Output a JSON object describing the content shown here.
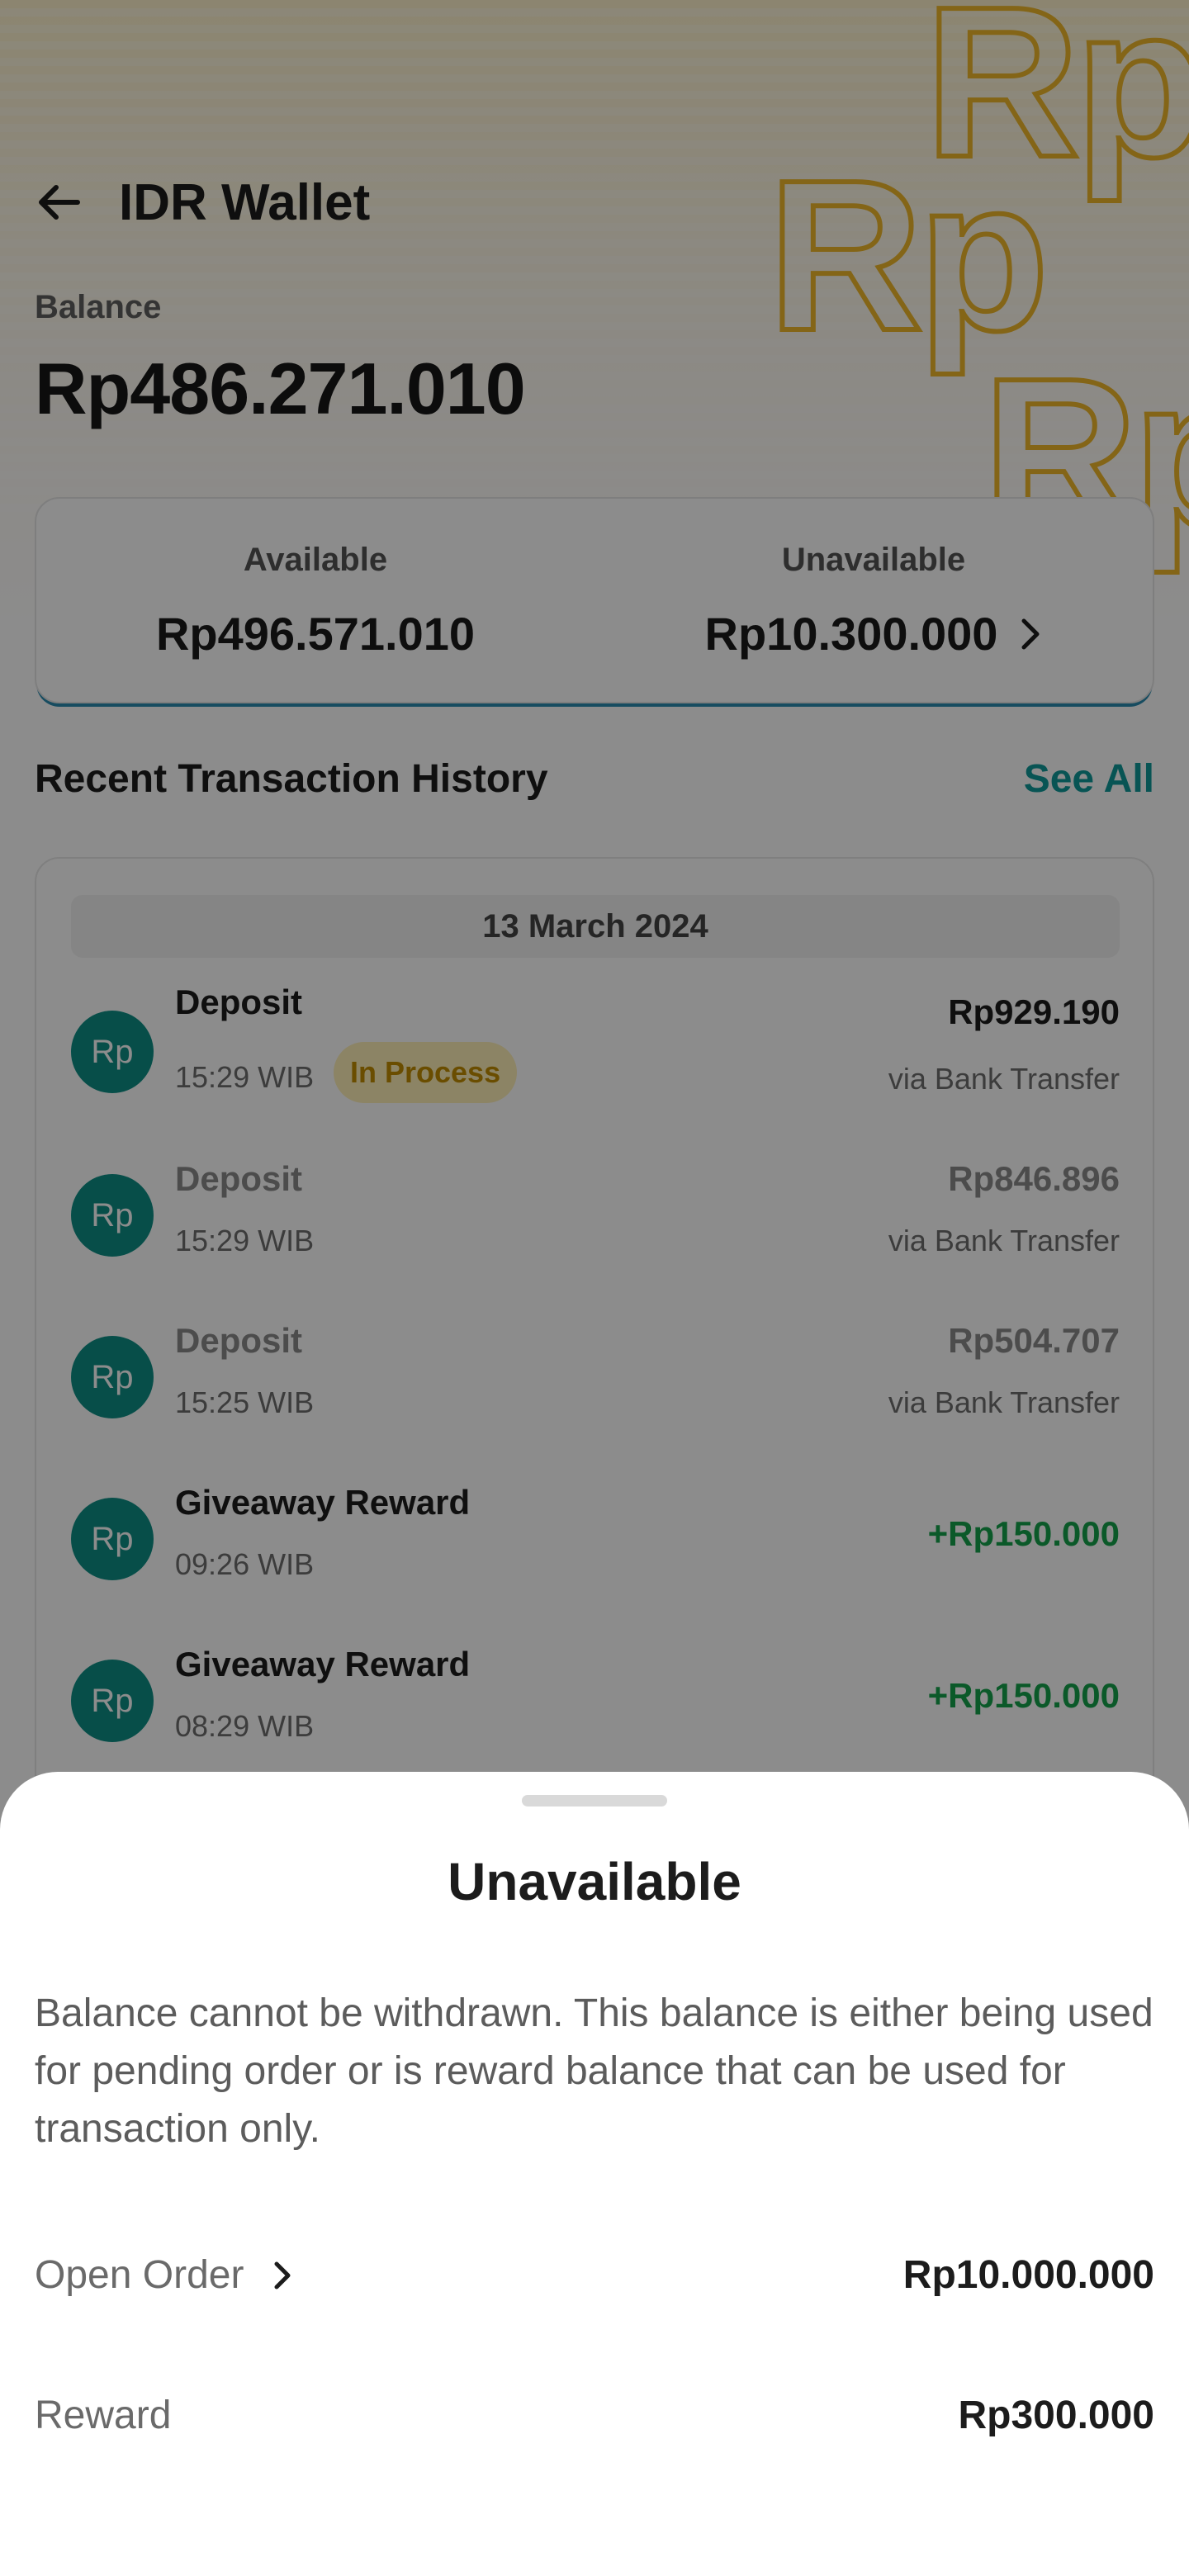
{
  "header": {
    "title": "IDR Wallet",
    "back_icon": "arrow-left-icon"
  },
  "balance": {
    "label": "Balance",
    "value": "Rp486.271.010"
  },
  "balance_card": {
    "available_label": "Available",
    "available_value": "Rp496.571.010",
    "unavailable_label": "Unavailable",
    "unavailable_value": "Rp10.300.000"
  },
  "recent": {
    "title": "Recent Transaction History",
    "see_all": "See All",
    "date": "13 March 2024",
    "transactions": [
      {
        "avatar": "Rp",
        "name": "Deposit",
        "time": "15:29 WIB",
        "status": "In Process",
        "amount": "Rp929.190",
        "method": "via Bank Transfer"
      },
      {
        "avatar": "Rp",
        "name": "Deposit",
        "time": "15:29 WIB",
        "amount": "Rp846.896",
        "method": "via Bank Transfer"
      },
      {
        "avatar": "Rp",
        "name": "Deposit",
        "time": "15:25 WIB",
        "amount": "Rp504.707",
        "method": "via Bank Transfer"
      },
      {
        "avatar": "Rp",
        "name": "Giveaway Reward",
        "time": "09:26 WIB",
        "amount": "+Rp150.000"
      },
      {
        "avatar": "Rp",
        "name": "Giveaway Reward",
        "time": "08:29 WIB",
        "amount": "+Rp150.000"
      }
    ]
  },
  "sheet": {
    "title": "Unavailable",
    "description": "Balance cannot be withdrawn. This balance is either being used for pending order or is reward balance that can be used for transaction only.",
    "rows": [
      {
        "label": "Open Order",
        "value": "Rp10.000.000"
      },
      {
        "label": "Reward",
        "value": "Rp300.000"
      }
    ]
  },
  "colors": {
    "accent": "#0f9a9a",
    "positive": "#14a24b",
    "status_bg": "#fff0b8",
    "status_text": "#c28c00",
    "watermark": "#f0b92a"
  }
}
